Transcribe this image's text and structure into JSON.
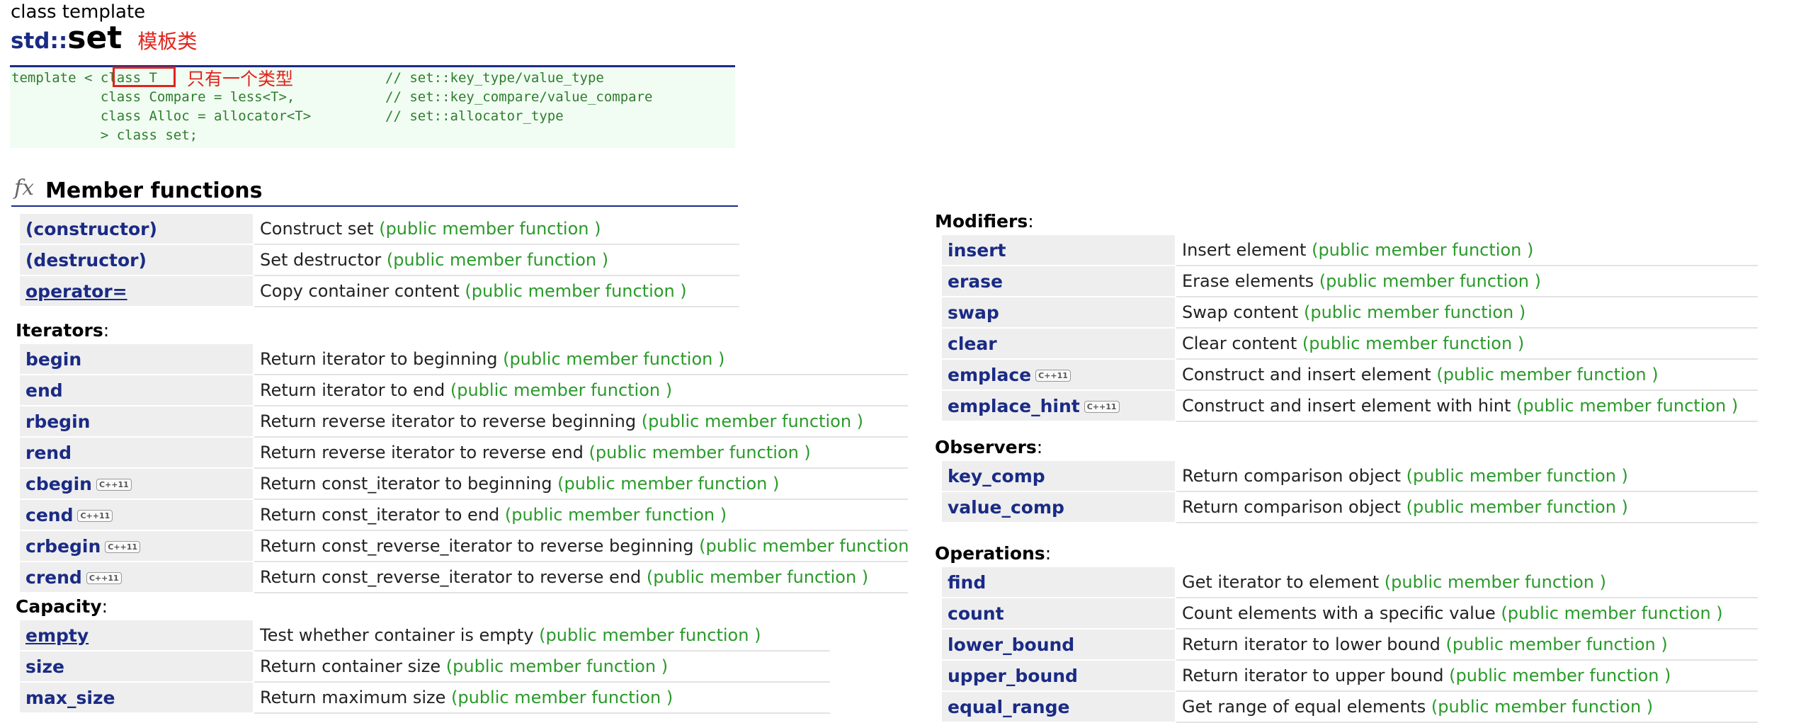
{
  "header": {
    "subtitle": "class template",
    "namespace": "std::",
    "name": "set",
    "note": "模板类"
  },
  "declaration": {
    "lines": [
      {
        "code": "template < class T",
        "comment": "// set::key_type/value_type"
      },
      {
        "code": "           class Compare = less<T>,",
        "comment": "// set::key_compare/value_compare"
      },
      {
        "code": "           class Alloc = allocator<T>",
        "comment": "// set::allocator_type"
      },
      {
        "code": "           > class set;",
        "comment": ""
      }
    ],
    "annotation": "只有一个类型"
  },
  "member_functions": {
    "icon": "fx-icon",
    "title": "Member functions",
    "public_label": "(public member function )",
    "cpp11_badge": "C++11",
    "main": [
      {
        "name": "(constructor)",
        "desc": "Construct set"
      },
      {
        "name": "(destructor)",
        "desc": "Set destructor"
      },
      {
        "name": "operator=",
        "desc": "Copy container content"
      }
    ],
    "iterators": {
      "label": "Iterators",
      "rows": [
        {
          "name": "begin",
          "desc": "Return iterator to beginning"
        },
        {
          "name": "end",
          "desc": "Return iterator to end"
        },
        {
          "name": "rbegin",
          "desc": "Return reverse iterator to reverse beginning"
        },
        {
          "name": "rend",
          "desc": "Return reverse iterator to reverse end"
        },
        {
          "name": "cbegin",
          "desc": "Return const_iterator to beginning"
        },
        {
          "name": "cend",
          "desc": "Return const_iterator to end"
        },
        {
          "name": "crbegin",
          "desc": "Return const_reverse_iterator to reverse beginning"
        },
        {
          "name": "crend",
          "desc": "Return const_reverse_iterator to reverse end"
        }
      ]
    },
    "capacity": {
      "label": "Capacity",
      "rows": [
        {
          "name": "empty",
          "desc": "Test whether container is empty"
        },
        {
          "name": "size",
          "desc": "Return container size"
        },
        {
          "name": "max_size",
          "desc": "Return maximum size"
        }
      ]
    },
    "modifiers": {
      "label": "Modifiers",
      "rows": [
        {
          "name": "insert",
          "desc": "Insert element"
        },
        {
          "name": "erase",
          "desc": "Erase elements"
        },
        {
          "name": "swap",
          "desc": "Swap content"
        },
        {
          "name": "clear",
          "desc": "Clear content"
        },
        {
          "name": "emplace",
          "desc": "Construct and insert element"
        },
        {
          "name": "emplace_hint",
          "desc": "Construct and insert element with hint"
        }
      ]
    },
    "observers": {
      "label": "Observers",
      "rows": [
        {
          "name": "key_comp",
          "desc": "Return comparison object"
        },
        {
          "name": "value_comp",
          "desc": "Return comparison object"
        }
      ]
    },
    "operations": {
      "label": "Operations",
      "rows": [
        {
          "name": "find",
          "desc": "Get iterator to element"
        },
        {
          "name": "count",
          "desc": "Count elements with a specific value"
        },
        {
          "name": "lower_bound",
          "desc": "Return iterator to lower bound"
        },
        {
          "name": "upper_bound",
          "desc": "Return iterator to upper bound"
        },
        {
          "name": "equal_range",
          "desc": "Get range of equal elements"
        }
      ]
    }
  }
}
